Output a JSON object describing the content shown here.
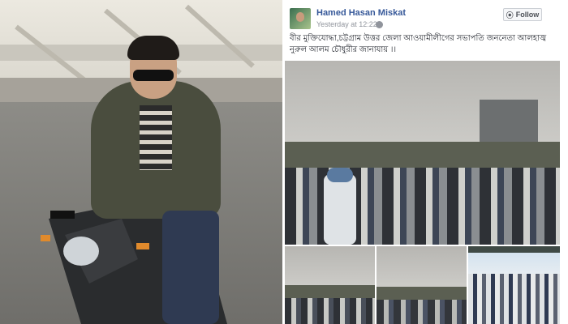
{
  "post": {
    "author": "Hamed Hasan Miskat",
    "timestamp": "Yesterday at 12:22 ·",
    "follow_label": "Follow",
    "caption": "বীর মুক্তিযোদ্ধা,চট্টগ্রাম উত্তর জেলা আওয়ামীলীগের সভাপতি জননেতা আলহাজ্ব নুরুল আলম চৌধুরীর জানাযায় ।।"
  },
  "icons": {
    "globe": "globe-icon",
    "follow": "rss-icon",
    "avatar": "avatar"
  },
  "colors": {
    "author_link": "#365899",
    "meta_text": "#90949c",
    "button_border": "#ccd0d5"
  }
}
